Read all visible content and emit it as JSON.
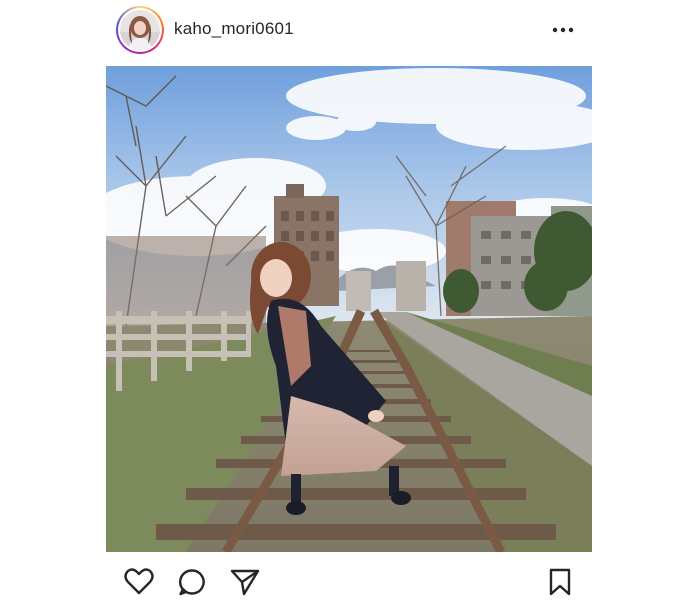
{
  "post": {
    "username": "kaho_mori0601"
  },
  "icons": {
    "avatar": "profile-avatar",
    "more": "more-options-icon",
    "like": "heart-icon",
    "comment": "comment-bubble-icon",
    "share": "paper-plane-icon",
    "save": "bookmark-icon"
  },
  "colors": {
    "text": "#262626",
    "story_ring": [
      "#feda75",
      "#fa7e1e",
      "#d62976",
      "#962fbf",
      "#4f5bd5"
    ]
  }
}
